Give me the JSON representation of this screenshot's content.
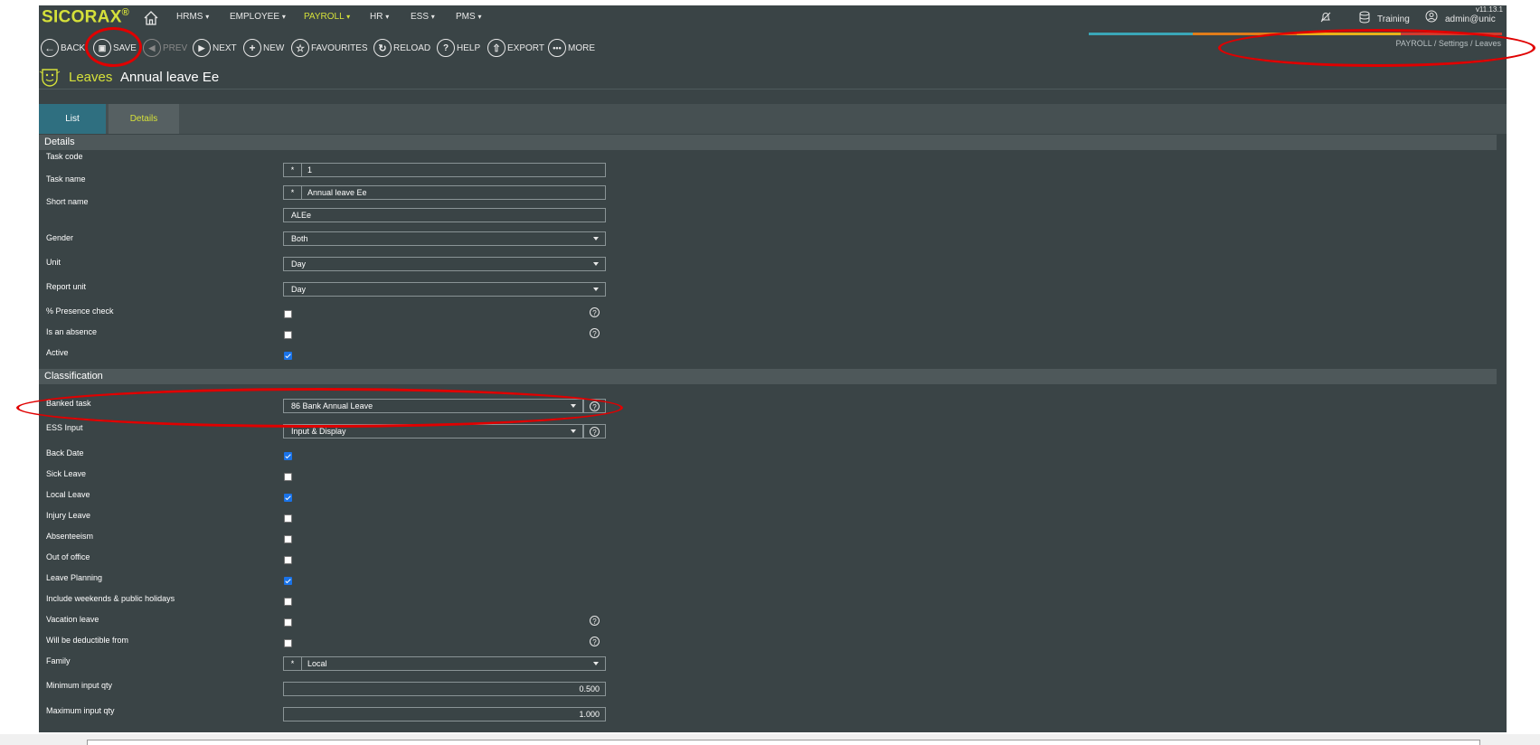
{
  "app": {
    "brand": "SICORAX",
    "version": "v11.13.1",
    "nav": [
      {
        "label": "HRMS",
        "active": false
      },
      {
        "label": "EMPLOYEE",
        "active": false
      },
      {
        "label": "PAYROLL",
        "active": true
      },
      {
        "label": "HR",
        "active": false
      },
      {
        "label": "ESS",
        "active": false
      },
      {
        "label": "PMS",
        "active": false
      }
    ],
    "database": "Training",
    "user": "admin@unic",
    "accent": "#d5e03a"
  },
  "toolbar": {
    "back": "BACK",
    "save": "SAVE",
    "prev": "PREV",
    "next": "NEXT",
    "new": "NEW",
    "favourites": "FAVOURITES",
    "reload": "RELOAD",
    "help": "HELP",
    "export": "EXPORT",
    "more": "MORE"
  },
  "breadcrumb": [
    "PAYROLL",
    "Settings",
    "Leaves"
  ],
  "page": {
    "module": "Leaves",
    "record_name": "Annual leave Ee"
  },
  "tabs": [
    "List",
    "Details"
  ],
  "sections": {
    "details": "Details",
    "classification": "Classification"
  },
  "fields": {
    "task_code": {
      "label": "Task code",
      "value": "1"
    },
    "task_name": {
      "label": "Task name",
      "value": "Annual leave Ee"
    },
    "short_name": {
      "label": "Short name",
      "value": "ALEe"
    },
    "gender": {
      "label": "Gender",
      "value": "Both"
    },
    "unit": {
      "label": "Unit",
      "value": "Day"
    },
    "report_unit": {
      "label": "Report unit",
      "value": "Day"
    },
    "presence_check": {
      "label": "% Presence check",
      "checked": false
    },
    "is_absence": {
      "label": "Is an absence",
      "checked": false
    },
    "active": {
      "label": "Active",
      "checked": true
    },
    "banked_task": {
      "label": "Banked task",
      "value": "86 Bank Annual Leave"
    },
    "ess_input": {
      "label": "ESS Input",
      "value": "Input & Display"
    },
    "back_date": {
      "label": "Back Date",
      "checked": true
    },
    "sick_leave": {
      "label": "Sick Leave",
      "checked": false
    },
    "local_leave": {
      "label": "Local Leave",
      "checked": true
    },
    "injury_leave": {
      "label": "Injury Leave",
      "checked": false
    },
    "absenteeism": {
      "label": "Absenteeism",
      "checked": false
    },
    "out_of_office": {
      "label": "Out of office",
      "checked": false
    },
    "leave_planning": {
      "label": "Leave Planning",
      "checked": true
    },
    "include_weekends": {
      "label": "Include weekends & public holidays",
      "checked": false
    },
    "vacation_leave": {
      "label": "Vacation leave",
      "checked": false
    },
    "deductible_from": {
      "label": "Will be deductible from",
      "checked": false
    },
    "family": {
      "label": "Family",
      "value": "Local"
    },
    "min_qty": {
      "label": "Minimum input qty",
      "value": "0.500"
    },
    "max_qty": {
      "label": "Maximum input qty",
      "value": "1.000"
    }
  },
  "required_marker": "*",
  "icons": [
    "home-icon",
    "notification-off-icon",
    "database-icon",
    "user-icon",
    "leaves-module-icon",
    "help-icon"
  ]
}
